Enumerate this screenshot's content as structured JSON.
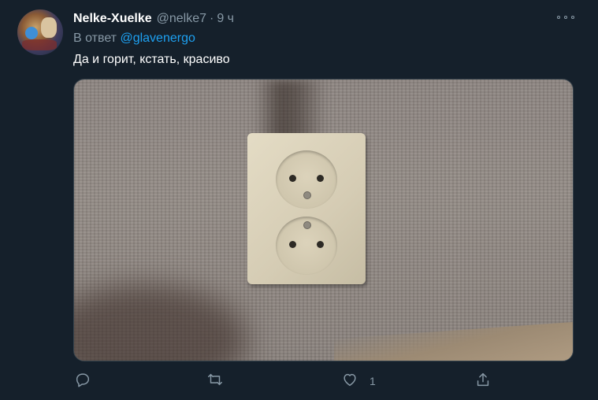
{
  "tweet": {
    "author_name": "Nelke-Xuelke",
    "handle": "@nelke7",
    "separator": "·",
    "time": "9 ч",
    "reply_prefix": "В ответ ",
    "reply_mention": "@glavenergo",
    "text": "Да и горит, кстать, красиво"
  },
  "actions": {
    "reply_icon": "comment-icon",
    "retweet_icon": "retweet-icon",
    "like_icon": "heart-icon",
    "like_count": "1",
    "share_icon": "share-icon",
    "more_icon": "more-dots-icon"
  },
  "colors": {
    "background": "#15202b",
    "secondary_text": "#8899a6",
    "accent": "#1da1f2"
  }
}
